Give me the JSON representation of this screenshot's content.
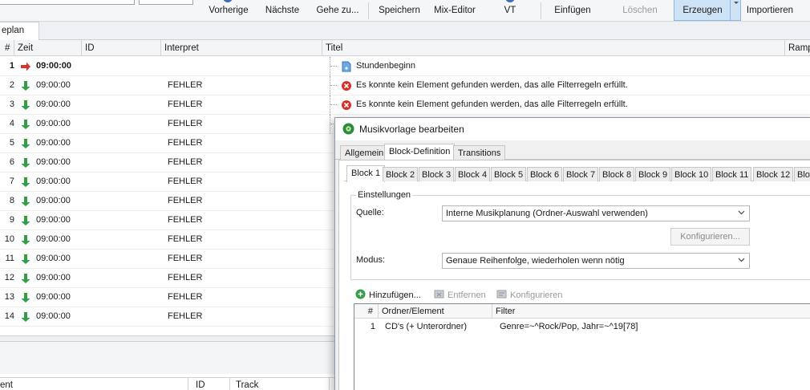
{
  "toolbar": {
    "buttons": [
      "Vorherige",
      "Nächste",
      "Gehe zu...",
      "Speichern",
      "Mix-Editor",
      "VT",
      "Einfügen",
      "Löschen",
      "Erzeugen",
      "Importieren"
    ]
  },
  "plan_tab": {
    "label": "eplan"
  },
  "grid": {
    "columns": [
      "#",
      "Zeit",
      "ID",
      "Interpret",
      "Titel",
      "Ramp"
    ],
    "rows": [
      {
        "num": "1",
        "time": "09:00:00",
        "artist": "",
        "title": "Stundenbeginn"
      },
      {
        "num": "2",
        "time": "09:00:00",
        "artist": "FEHLER",
        "title": "Es konnte kein Element gefunden werden, das alle Filterregeln erfüllt."
      },
      {
        "num": "3",
        "time": "09:00:00",
        "artist": "FEHLER",
        "title": "Es konnte kein Element gefunden werden, das alle Filterregeln erfüllt."
      },
      {
        "num": "4",
        "time": "09:00:00",
        "artist": "FEHLER",
        "title": ""
      },
      {
        "num": "5",
        "time": "09:00:00",
        "artist": "FEHLER",
        "title": ""
      },
      {
        "num": "6",
        "time": "09:00:00",
        "artist": "FEHLER",
        "title": ""
      },
      {
        "num": "7",
        "time": "09:00:00",
        "artist": "FEHLER",
        "title": ""
      },
      {
        "num": "8",
        "time": "09:00:00",
        "artist": "FEHLER",
        "title": ""
      },
      {
        "num": "9",
        "time": "09:00:00",
        "artist": "FEHLER",
        "title": ""
      },
      {
        "num": "10",
        "time": "09:00:00",
        "artist": "FEHLER",
        "title": ""
      },
      {
        "num": "11",
        "time": "09:00:00",
        "artist": "FEHLER",
        "title": ""
      },
      {
        "num": "12",
        "time": "09:00:00",
        "artist": "FEHLER",
        "title": ""
      },
      {
        "num": "13",
        "time": "09:00:00",
        "artist": "FEHLER",
        "title": ""
      },
      {
        "num": "14",
        "time": "09:00:00",
        "artist": "FEHLER",
        "title": ""
      }
    ]
  },
  "lower": {
    "columns": [
      "ent",
      "ID",
      "Track"
    ]
  },
  "dialog": {
    "title": "Musikvorlage bearbeiten",
    "tabs": [
      "Allgemein",
      "Block-Definition",
      "Transitions"
    ],
    "block_tabs": [
      "Block 1",
      "Block 2",
      "Block 3",
      "Block 4",
      "Block 5",
      "Block 6",
      "Block 7",
      "Block 8",
      "Block 9",
      "Block 10",
      "Block 11",
      "Block 12",
      "Bloc"
    ],
    "group_label": "Einstellungen",
    "quelle_label": "Quelle:",
    "quelle_value": "Interne Musikplanung (Ordner-Auswahl verwenden)",
    "configure_button": "Konfigurieren...",
    "modus_label": "Modus:",
    "modus_value": "Genaue Reihenfolge, wiederholen wenn nötig",
    "actions": {
      "add": "Hinzufügen...",
      "remove": "Entfernen",
      "configure": "Konfigurieren"
    },
    "list": {
      "columns": [
        "#",
        "Ordner/Element",
        "Filter"
      ],
      "rows": [
        {
          "num": "1",
          "element": "CD's (+ Unterordner)",
          "filter": "Genre=~^Rock/Pop, Jahr=~^19[78]"
        }
      ]
    }
  },
  "colors": {
    "accent": "#cfe3f7",
    "ok_arrow": "#2f9e44",
    "start_arrow": "#d9342b",
    "error": "#d93025"
  }
}
